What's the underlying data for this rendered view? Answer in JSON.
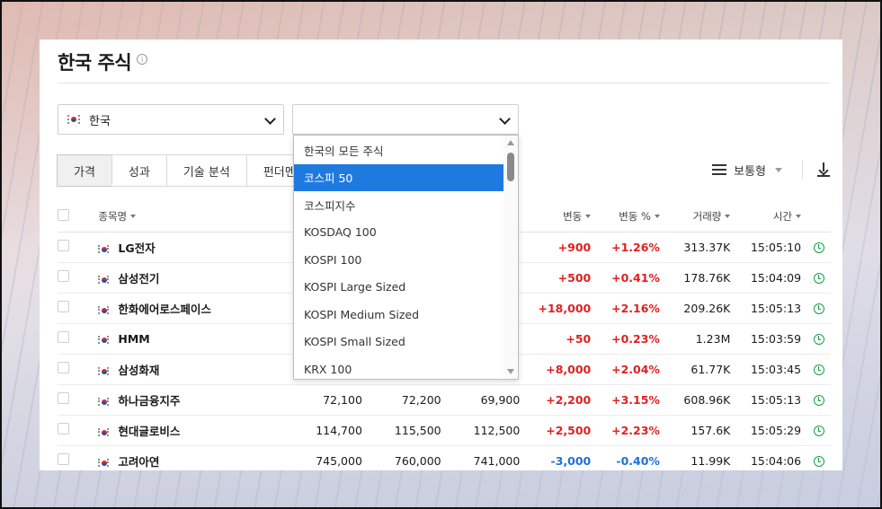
{
  "page": {
    "title": "한국 주식",
    "info_icon": "ⓘ"
  },
  "filters": {
    "country_flag": "kr-flag-icon",
    "country_value": "한국",
    "index_value": ""
  },
  "tabs": [
    "가격",
    "성과",
    "기술 분석",
    "펀더멘"
  ],
  "toolbar": {
    "view_label": "보통형"
  },
  "table": {
    "headers": {
      "name": "종목명",
      "change": "변동",
      "change_pct": "변동 %",
      "volume": "거래량",
      "time": "시간"
    },
    "rows": [
      {
        "name": "LG전자",
        "last": "",
        "high": "",
        "low": "",
        "change": "+900",
        "change_pct": "+1.26%",
        "volume": "313.37K",
        "time": "15:05:10",
        "dir": "pos"
      },
      {
        "name": "삼성전기",
        "last": "",
        "high": "",
        "low": "",
        "change": "+500",
        "change_pct": "+0.41%",
        "volume": "178.76K",
        "time": "15:04:09",
        "dir": "pos"
      },
      {
        "name": "한화에어로스페이스",
        "last": "",
        "high": "",
        "low": "",
        "change": "+18,000",
        "change_pct": "+2.16%",
        "volume": "209.26K",
        "time": "15:05:13",
        "dir": "pos"
      },
      {
        "name": "HMM",
        "last": "",
        "high": "",
        "low": "",
        "change": "+50",
        "change_pct": "+0.23%",
        "volume": "1.23M",
        "time": "15:03:59",
        "dir": "pos"
      },
      {
        "name": "삼성화재",
        "last": "",
        "high": "",
        "low": "",
        "change": "+8,000",
        "change_pct": "+2.04%",
        "volume": "61.77K",
        "time": "15:03:45",
        "dir": "pos"
      },
      {
        "name": "하나금융지주",
        "last": "72,100",
        "high": "72,200",
        "low": "69,900",
        "change": "+2,200",
        "change_pct": "+3.15%",
        "volume": "608.96K",
        "time": "15:05:13",
        "dir": "pos"
      },
      {
        "name": "현대글로비스",
        "last": "114,700",
        "high": "115,500",
        "low": "112,500",
        "change": "+2,500",
        "change_pct": "+2.23%",
        "volume": "157.6K",
        "time": "15:05:29",
        "dir": "pos"
      },
      {
        "name": "고려아연",
        "last": "745,000",
        "high": "760,000",
        "low": "741,000",
        "change": "-3,000",
        "change_pct": "-0.40%",
        "volume": "11.99K",
        "time": "15:04:06",
        "dir": "neg"
      }
    ]
  },
  "dropdown": {
    "selected_index": 1,
    "options": [
      "한국의 모든 주식",
      "코스피 50",
      "코스피지수",
      "KOSDAQ 100",
      "KOSPI 100",
      "KOSPI Large Sized",
      "KOSPI Medium Sized",
      "KOSPI Small Sized",
      "KRX 100"
    ]
  },
  "colors": {
    "positive": "#e02020",
    "negative": "#1f6fd6",
    "selected": "#1f7ae0",
    "clock": "#1a9e45"
  }
}
